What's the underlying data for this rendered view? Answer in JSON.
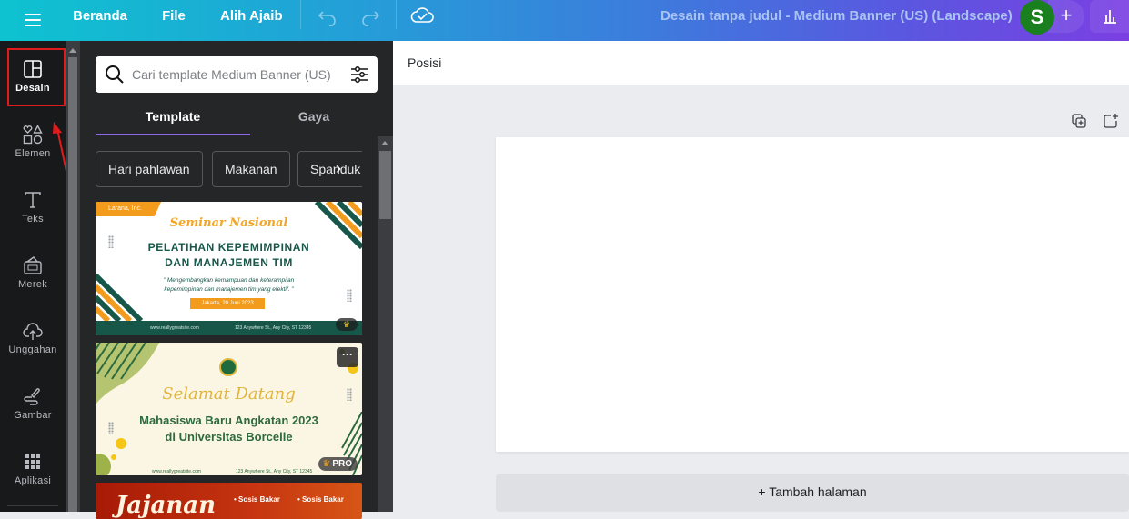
{
  "topbar": {
    "nav": [
      "Beranda",
      "File",
      "Alih Ajaib"
    ],
    "document_title": "Desain tanpa judul - Medium Banner (US) (Landscape)",
    "avatar_initial": "S",
    "add_label": "+",
    "icons": [
      "menu-icon",
      "undo-icon",
      "redo-icon",
      "cloud-saved-icon",
      "insights-icon"
    ]
  },
  "sidebar": {
    "items": [
      {
        "label": "Desain",
        "icon": "layout-icon",
        "active": true
      },
      {
        "label": "Elemen",
        "icon": "shapes-icon",
        "active": false
      },
      {
        "label": "Teks",
        "icon": "text-icon",
        "active": false
      },
      {
        "label": "Merek",
        "icon": "brand-icon",
        "active": false
      },
      {
        "label": "Unggahan",
        "icon": "upload-icon",
        "active": false
      },
      {
        "label": "Gambar",
        "icon": "draw-icon",
        "active": false
      },
      {
        "label": "Aplikasi",
        "icon": "apps-icon",
        "active": false
      }
    ]
  },
  "panel": {
    "search_placeholder": "Cari template Medium Banner (US)",
    "tabs": [
      {
        "label": "Template",
        "active": true
      },
      {
        "label": "Gaya",
        "active": false
      }
    ],
    "chips": [
      "Hari pahlawan",
      "Makanan",
      "Spanduk"
    ],
    "templates": [
      {
        "company": "Larana, Inc.",
        "script_title": "Seminar Nasional",
        "heading_1": "PELATIHAN KEPEMIMPINAN",
        "heading_2": "DAN MANAJEMEN TIM",
        "quote_1": "\" Mengembangkan kemampuan dan keterampilan",
        "quote_2": "kepemimpinan dan manajemen tim yang efektif. \"",
        "date": "Jakarta, 20 Juni 2023",
        "website": "www.reallygreatsite.com",
        "address": "123 Anywhere St., Any City, ST 12345",
        "badge": "♛"
      },
      {
        "script_title": "Selamat Datang",
        "heading_1": "Mahasiswa Baru Angkatan 2023",
        "heading_2": "di Universitas Borcelle",
        "website": "www.reallygreatsite.com",
        "address": "123 Anywhere St., Any City, ST 12345",
        "badge": "PRO",
        "more_label": "···"
      },
      {
        "script_title": "Jajanan",
        "items": [
          "• Sosis Bakar",
          "• Sosis Bakar"
        ]
      }
    ]
  },
  "editor": {
    "toolbar_position": "Posisi",
    "add_page": "+ Tambah halaman"
  },
  "annotation": {
    "highlight_color": "#e01b1b"
  }
}
